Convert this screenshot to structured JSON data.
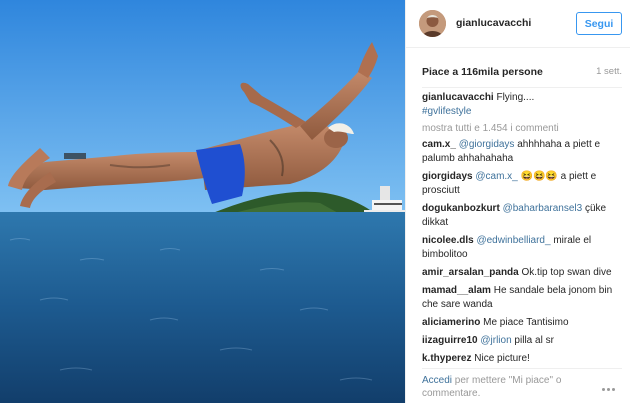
{
  "post": {
    "username": "gianlucavacchi",
    "follow_label": "Segui",
    "likes": "Piace a 116mila persone",
    "time": "1 sett.",
    "caption": {
      "username": "gianlucavacchi",
      "text": " Flying....",
      "hashtag": "#gvlifestyle"
    },
    "show_all": "mostra tutti e 1.454 i commenti",
    "comments": [
      {
        "user": "cam.x_",
        "mention": "@giorgidays",
        "text": " ahhhhaha a piett e palumb ahhahahaha"
      },
      {
        "user": "giorgidays",
        "mention": "@cam.x_",
        "text": " 😆😆😆 a piett e prosciutt"
      },
      {
        "user": "dogukanbozkurt",
        "mention": "@baharbaransel3",
        "text": " çüke dikkat"
      },
      {
        "user": "nicolee.dls",
        "mention": "@edwinbelliard_",
        "text": " mirale el bimbolitoo"
      },
      {
        "user": "amir_arsalan_panda",
        "mention": "",
        "text": " Ok.tip top swan dive"
      },
      {
        "user": "mamad__alam",
        "mention": "",
        "text": " He sandale bela jonom bin che sare wanda"
      },
      {
        "user": "aliciamerino",
        "mention": "",
        "text": " Me piace Tantisimo"
      },
      {
        "user": "iizaguirre10",
        "mention": "@jrlion",
        "text": " pilla al sr"
      },
      {
        "user": "k.thyperez",
        "mention": "",
        "text": " Nice picture!"
      }
    ],
    "add_comment": {
      "login": "Accedi",
      "text": " per mettere \"Mi piace\" o commentare."
    }
  },
  "colors": {
    "link": "#3f729b",
    "follow": "#3897f0",
    "muted": "#999999",
    "sea": "#1f5f99",
    "sky": "#3f93e6"
  },
  "icons": [
    "more-options-icon"
  ]
}
